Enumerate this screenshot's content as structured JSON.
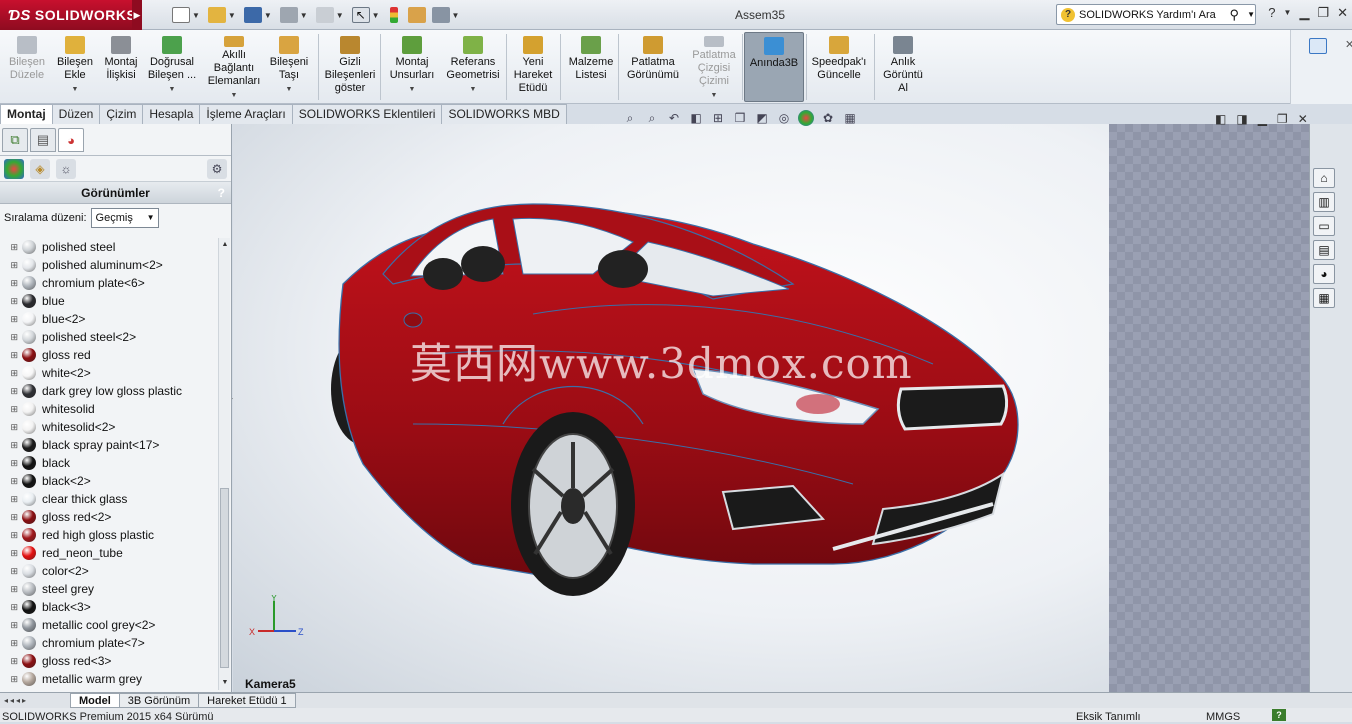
{
  "app": {
    "brand": "SOLIDWORKS",
    "doc_title": "Assem35"
  },
  "help_search": {
    "placeholder": "SOLIDWORKS Yardım'ı Ara"
  },
  "ribbon": [
    {
      "label": "Bileşen\nDüzele",
      "color": "#b8bec6",
      "dim": true
    },
    {
      "label": "Bileşen\nEkle",
      "color": "#e0b13c"
    },
    {
      "label": "Montaj\nİlişkisi",
      "color": "#8b8f96"
    },
    {
      "label": "Doğrusal\nBileşen ...",
      "color": "#4ca14c"
    },
    {
      "label": "Akıllı\nBağlantı\nElemanları",
      "color": "#d6a23b"
    },
    {
      "label": "Bileşeni\nTaşı",
      "color": "#d9a441"
    },
    {
      "label": "Gizli\nBileşenleri\ngöster",
      "color": "#b9872f"
    },
    {
      "label": "Montaj\nUnsurları",
      "color": "#5e9e3d"
    },
    {
      "label": "Referans\nGeometrisi",
      "color": "#7fb247"
    },
    {
      "label": "Yeni\nHareket\nEtüdü",
      "color": "#d4a12f"
    },
    {
      "label": "Malzeme\nListesi",
      "color": "#6aa04a"
    },
    {
      "label": "Patlatma\nGörünümü",
      "color": "#cf9b31"
    },
    {
      "label": "Patlatma\nÇizgisi\nÇizimi",
      "color": "#b8bec6",
      "dim": true
    },
    {
      "label": "Anında3B",
      "color": "#3b8fd4",
      "active": true
    },
    {
      "label": "Speedpak'ı\nGüncelle",
      "color": "#d8a63b"
    },
    {
      "label": "Anlık\nGörüntü\nAl",
      "color": "#7a8591"
    }
  ],
  "tabs": [
    "Montaj",
    "Düzen",
    "Çizim",
    "Hesapla",
    "İşleme Araçları",
    "SOLIDWORKS Eklentileri",
    "SOLIDWORKS MBD"
  ],
  "left_panel": {
    "title": "Görünümler",
    "help": "?",
    "sort_label": "Sıralama düzeni:",
    "sort_value": "Geçmiş",
    "appearances": [
      {
        "name": "polished steel",
        "color": "#cfd3d7"
      },
      {
        "name": "polished aluminum<2>",
        "color": "#e3e6ea"
      },
      {
        "name": "chromium plate<6>",
        "color": "#aeb4bb"
      },
      {
        "name": "blue",
        "color": "#2a2a2e"
      },
      {
        "name": "blue<2>",
        "color": "#f3f4f6"
      },
      {
        "name": "polished steel<2>",
        "color": "#d2d6da"
      },
      {
        "name": "gloss red",
        "color": "#8b0f12"
      },
      {
        "name": "white<2>",
        "color": "#f6f6f6"
      },
      {
        "name": "dark grey low gloss plastic",
        "color": "#2f3034"
      },
      {
        "name": "whitesolid",
        "color": "#f2f2f2"
      },
      {
        "name": "whitesolid<2>",
        "color": "#f2f2f2"
      },
      {
        "name": "black spray paint<17>",
        "color": "#1a1a1a"
      },
      {
        "name": "black",
        "color": "#111111"
      },
      {
        "name": "black<2>",
        "color": "#111111"
      },
      {
        "name": "clear thick glass",
        "color": "#e9eef2"
      },
      {
        "name": "gloss red<2>",
        "color": "#8b0f12"
      },
      {
        "name": "red high gloss plastic",
        "color": "#a0171b"
      },
      {
        "name": "red_neon_tube",
        "color": "#e31010"
      },
      {
        "name": "color<2>",
        "color": "#d9dde2"
      },
      {
        "name": "steel grey",
        "color": "#b9bdc2"
      },
      {
        "name": "black<3>",
        "color": "#111111"
      },
      {
        "name": "metallic cool grey<2>",
        "color": "#8f959c"
      },
      {
        "name": "chromium plate<7>",
        "color": "#aeb4bb"
      },
      {
        "name": "gloss red<3>",
        "color": "#8b0f12"
      },
      {
        "name": "metallic warm grey",
        "color": "#b4a79d"
      }
    ]
  },
  "viewport": {
    "watermark": "莫西网www.3dmox.com",
    "camera": "Kamera5",
    "triad": {
      "x": "X",
      "y": "Y",
      "z": "Z"
    }
  },
  "bottom_tabs": [
    "Model",
    "3B Görünüm",
    "Hareket Etüdü 1"
  ],
  "status": {
    "left": "SOLIDWORKS Premium 2015 x64 Sürümü",
    "definition": "Eksik Tanımlı",
    "units": "MMGS",
    "help": "?"
  }
}
